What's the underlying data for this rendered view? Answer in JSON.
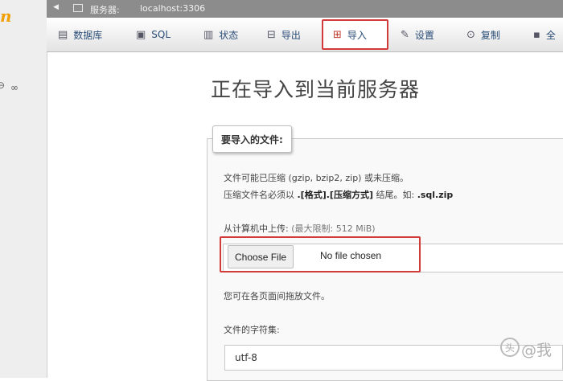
{
  "server_bar": {
    "arrow": "◀",
    "label": "服务器:",
    "host": "localhost:3306"
  },
  "tabs": [
    {
      "icon": "database-icon",
      "glyph": "▤",
      "label": "数据库"
    },
    {
      "icon": "sql-icon",
      "glyph": "▣",
      "label": "SQL"
    },
    {
      "icon": "status-icon",
      "glyph": "▥",
      "label": "状态"
    },
    {
      "icon": "export-icon",
      "glyph": "⊟",
      "label": "导出"
    },
    {
      "icon": "import-icon",
      "glyph": "⊞",
      "label": "导入"
    },
    {
      "icon": "settings-icon",
      "glyph": "✎",
      "label": "设置"
    },
    {
      "icon": "replication-icon",
      "glyph": "⊙",
      "label": "复制"
    },
    {
      "icon": "more-icon",
      "glyph": "▪",
      "label": "全"
    }
  ],
  "left_nav": {
    "logo": "n",
    "toggle": "⊖",
    "link_icon": "∞"
  },
  "main": {
    "title": "正在导入到当前服务器",
    "legend": "要导入的文件:",
    "compression_line1": "文件可能已压缩 (gzip, bzip2, zip) 或未压缩。",
    "compression_line2_a": "压缩文件名必须以",
    "compression_line2_b": ".[格式].[压缩方式]",
    "compression_line2_c": "结尾。如:",
    "compression_line2_d": ".sql.zip",
    "upload_label": "从计算机中上传:",
    "upload_limit": "(最大限制: 512 MiB)",
    "choose_file_label": "Choose File",
    "file_status": "No file chosen",
    "drag_hint": "您可在各页面间拖放文件。",
    "charset_label": "文件的字符集:",
    "charset_value": "utf-8"
  },
  "watermark": {
    "mark": "头",
    "text": "@我"
  },
  "colors": {
    "highlight_frame": "#d33b3b",
    "server_bar": "#8c8c8c",
    "tab_text": "#2a4d77",
    "logo": "#f0a000"
  }
}
